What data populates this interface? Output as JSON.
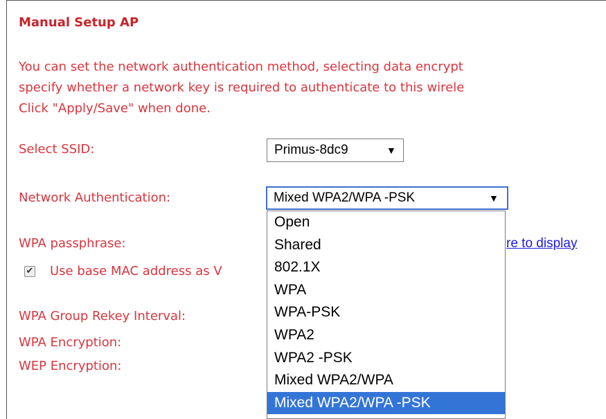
{
  "page": {
    "title": "Manual Setup AP",
    "description": [
      "You can set the network authentication method, selecting data encrypt",
      "specify whether a network key is required to authenticate to this wirele",
      "Click \"Apply/Save\" when done."
    ]
  },
  "form": {
    "ssid_label": "Select SSID:",
    "ssid_value": "Primus-8dc9",
    "auth_label": "Network Authentication:",
    "auth_value": "Mixed WPA2/WPA -PSK",
    "passphrase_label": "WPA passphrase:",
    "passphrase_link": "re to display",
    "checkbox_label": "Use base MAC address as V",
    "checkbox_checked": true,
    "rekey_label": "WPA Group Rekey Interval:",
    "wpa_enc_label": "WPA Encryption:",
    "wep_enc_label": "WEP Encryption:"
  },
  "auth_options": [
    "Open",
    "Shared",
    "802.1X",
    "WPA",
    "WPA-PSK",
    "WPA2",
    "WPA2 -PSK",
    "Mixed WPA2/WPA",
    "Mixed WPA2/WPA -PSK"
  ],
  "selected_option_index": 8,
  "icons": {
    "dropdown_arrow": "▼",
    "checkmark": "✔"
  },
  "colors": {
    "label_red": "#d9363e",
    "title_red": "#c8242b",
    "highlight_blue": "#3375d7",
    "focus_border": "#3d6fcf",
    "link_blue": "#1a1ae6"
  }
}
